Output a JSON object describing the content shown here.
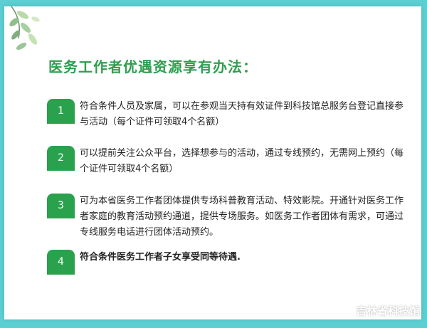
{
  "title": "医务工作者优遇资源享有办法：",
  "items": [
    {
      "number": "1",
      "text": "符合条件人员及家属，可以在参观当天持有效证件到科技馆总服务台登记直接参与活动（每个证件可领取4个名额）"
    },
    {
      "number": "2",
      "text": "可以提前关注公众平台，选择想参与的活动，通过专线预约，无需网上预约（每个证件可领取4个名额）"
    },
    {
      "number": "3",
      "text": "可为本省医务工作者团体提供专场科普教育活动、特效影院。开通针对医务工作者家庭的教育活动预约通道，提供专场服务。如医务工作者团体有需求，可通过专线服务电话进行团体活动预约。"
    },
    {
      "number": "4",
      "text": "符合条件医务工作者子女享受同等待遇."
    }
  ],
  "footer": {
    "label": "吉林省科技馆",
    "icon": "wechat-icon"
  },
  "colors": {
    "accent": "#2aa24d",
    "title": "#2f9e4f",
    "background": "#5ccfd2"
  }
}
